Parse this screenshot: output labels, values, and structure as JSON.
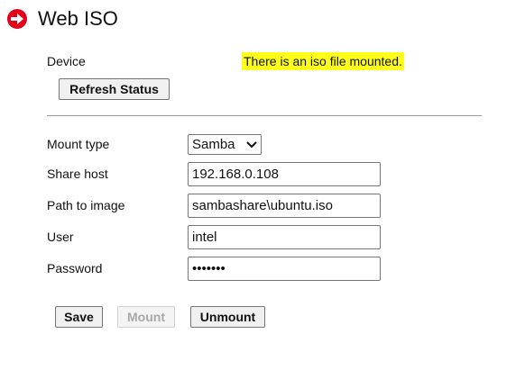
{
  "header": {
    "title": "Web ISO",
    "icon": "arrow-right-circle-icon",
    "icon_color": "#e4001b"
  },
  "device": {
    "label": "Device",
    "status_message": "There is an iso file mounted.",
    "status_highlight_color": "#ffff1a",
    "refresh_button_label": "Refresh Status"
  },
  "form": {
    "mount_type": {
      "label": "Mount type",
      "selected": "Samba"
    },
    "share_host": {
      "label": "Share host",
      "value": "192.168.0.108"
    },
    "path_to_image": {
      "label": "Path to image",
      "value": "sambashare\\ubuntu.iso"
    },
    "user": {
      "label": "User",
      "value": "intel"
    },
    "password": {
      "label": "Password",
      "value": "passwrd"
    }
  },
  "actions": {
    "save_label": "Save",
    "mount_label": "Mount",
    "mount_enabled": false,
    "unmount_label": "Unmount"
  }
}
